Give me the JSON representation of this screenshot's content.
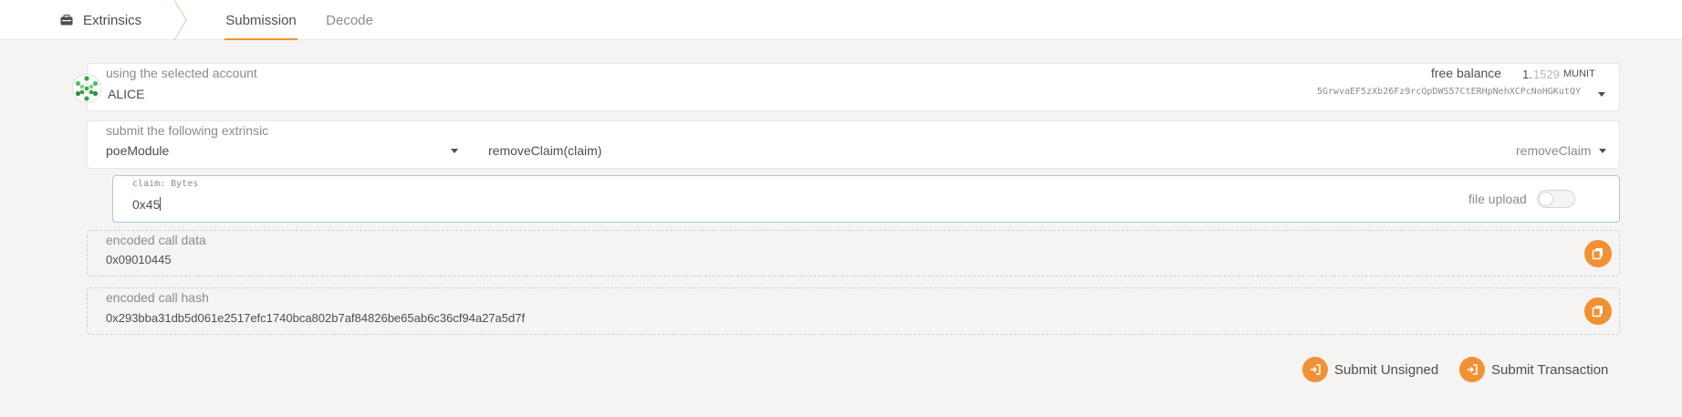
{
  "header": {
    "section_label": "Extrinsics",
    "tabs": [
      {
        "label": "Submission",
        "active": true
      },
      {
        "label": "Decode",
        "active": false
      }
    ]
  },
  "account": {
    "label": "using the selected account",
    "name": "ALICE",
    "balance_label": "free balance",
    "balance_whole": "1.",
    "balance_fraction": "1529",
    "balance_unit": "MUNIT",
    "address": "5GrwvaEF5zXb26Fz9rcQpDWS57CtERHpNehXCPcNoHGKutQY"
  },
  "extrinsic": {
    "label": "submit the following extrinsic",
    "module": "poeModule",
    "call": "removeClaim(claim)",
    "method": "removeClaim"
  },
  "param": {
    "label": "claim: Bytes",
    "value": "0x45",
    "file_upload_label": "file upload",
    "file_upload_enabled": false
  },
  "encoded_data": {
    "label": "encoded call data",
    "value": "0x09010445"
  },
  "encoded_hash": {
    "label": "encoded call hash",
    "value": "0x293bba31db5d061e2517efc1740bca802b7af84826be65ab6c36cf94a27a5d7f"
  },
  "actions": {
    "submit_unsigned": "Submit Unsigned",
    "submit_transaction": "Submit Transaction"
  },
  "colors": {
    "accent": "#f19135",
    "focus_border": "#a9c7e4",
    "identicon_green": "#38a84a"
  },
  "icons": {
    "section": "toolbox-icon",
    "copy": "copy-icon",
    "submit": "sign-in-icon"
  }
}
